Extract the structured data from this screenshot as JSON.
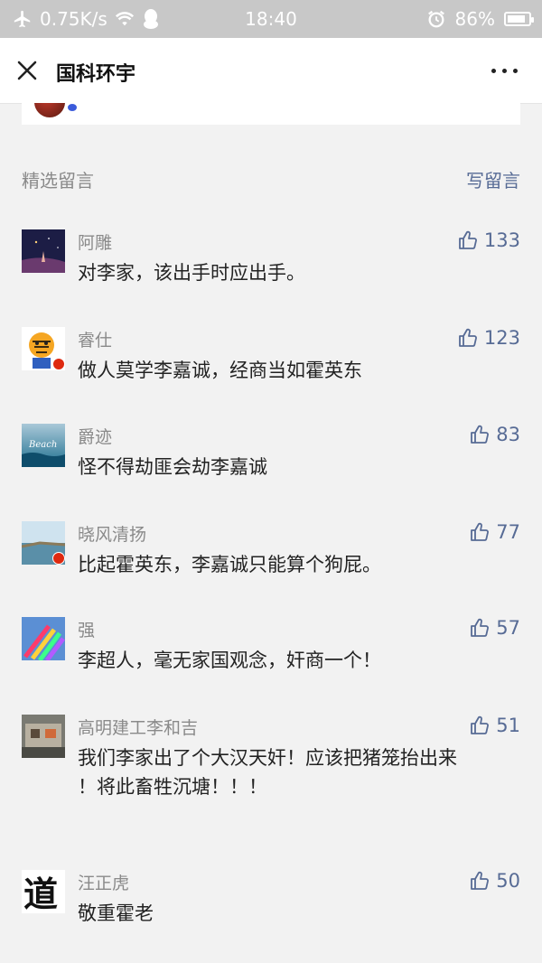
{
  "status_bar": {
    "speed": "0.75K/s",
    "time": "18:40",
    "battery": "86%",
    "battery_level": 0.86
  },
  "nav": {
    "title": "国科环宇",
    "close_icon": "close-icon",
    "more_icon": "more-icon"
  },
  "comments_section": {
    "label": "精选留言",
    "write_label": "写留言"
  },
  "comments": [
    {
      "name": "阿雕",
      "likes": "133",
      "text": "对李家，该出手时应出手。"
    },
    {
      "name": "睿仕",
      "likes": "123",
      "text": "做人莫学李嘉诚，经商当如霍英东"
    },
    {
      "name": "爵迹",
      "likes": "83",
      "text": "怪不得劫匪会劫李嘉诚",
      "avatar_text": "Beach"
    },
    {
      "name": "晓风清扬",
      "likes": "77",
      "text": "比起霍英东，李嘉诚只能算个狗屁。"
    },
    {
      "name": "强",
      "likes": "57",
      "text": "李超人，毫无家国观念，奸商一个！"
    },
    {
      "name": "高明建工李和吉",
      "likes": "51",
      "text": "我们李家出了个大汉天奸！应该把猪笼抬出来\n！将此畜牲沉塘！！！"
    },
    {
      "name": "汪正虎",
      "likes": "50",
      "text": "敬重霍老",
      "avatar_text": "道"
    }
  ]
}
